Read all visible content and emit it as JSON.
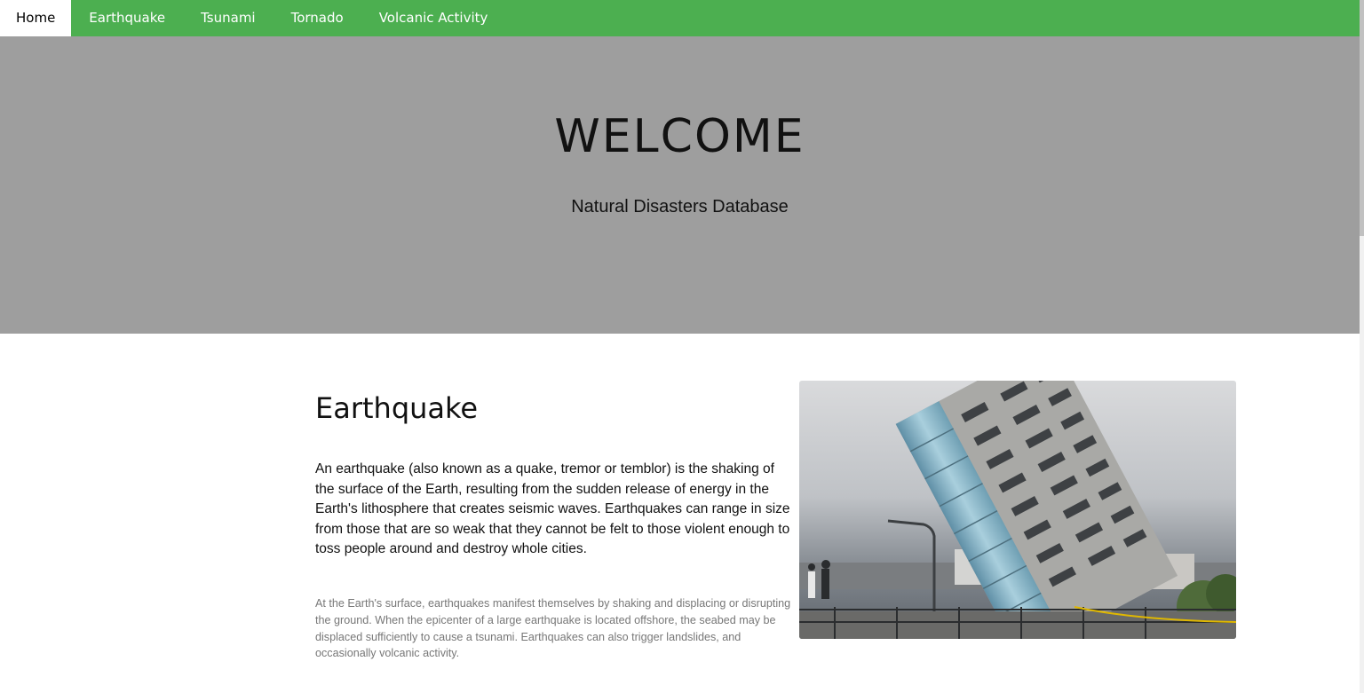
{
  "nav": {
    "items": [
      {
        "label": "Home",
        "active": true
      },
      {
        "label": "Earthquake",
        "active": false
      },
      {
        "label": "Tsunami",
        "active": false
      },
      {
        "label": "Tornado",
        "active": false
      },
      {
        "label": "Volcanic Activity",
        "active": false
      }
    ]
  },
  "hero": {
    "title": "WELCOME",
    "subtitle": "Natural Disasters Database"
  },
  "section": {
    "heading": "Earthquake",
    "lead": "An earthquake (also known as a quake, tremor or temblor) is the shaking of the surface of the Earth, resulting from the sudden release of energy in the Earth's lithosphere that creates seismic waves. Earthquakes can range in size from those that are so weak that they cannot be felt to those violent enough to toss people around and destroy whole cities.",
    "body": "At the Earth's surface, earthquakes manifest themselves by shaking and displacing or disrupting the ground. When the epicenter of a large earthquake is located offshore, the seabed may be displaced sufficiently to cause a tsunami. Earthquakes can also trigger landslides, and occasionally volcanic activity."
  },
  "colors": {
    "nav_bg": "#4caf50",
    "hero_bg": "#9e9e9e",
    "body_muted": "#777777"
  }
}
